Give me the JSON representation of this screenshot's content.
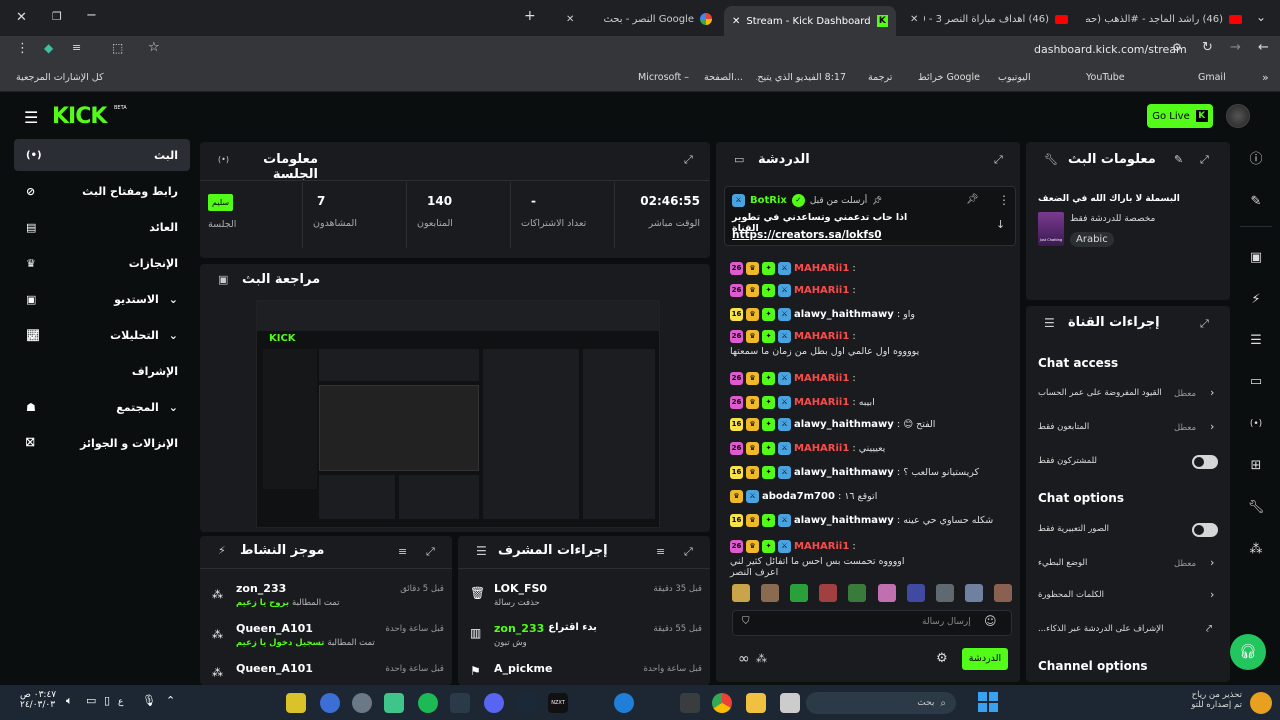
{
  "browser": {
    "tabs": [
      {
        "label": "(46) راشد الماجد - #الذهب (حصر"
      },
      {
        "label": "(46) أهداف مباراة النصر 3 - 0 الـ"
      },
      {
        "label": "Stream - Kick Dashboard"
      },
      {
        "label": "النصر - بحث Google"
      }
    ],
    "url": "dashboard.kick.com/stream",
    "bookmarks": [
      "Gmail",
      "YouTube",
      "اليوتيوب",
      "خرائط Google",
      "ترجمة",
      "8:17 الفيديو الذي يتيح...",
      "الصفحة...",
      "Microsoft –"
    ],
    "all_bookmarks": "كل الإشارات المرجعية"
  },
  "header": {
    "logo": "KICK",
    "beta": "BETA",
    "go_live": "Go Live"
  },
  "sidebar": {
    "items": [
      {
        "label": "البث",
        "icon": "broadcast-icon"
      },
      {
        "label": "رابط ومفتاح البث",
        "icon": "link-icon"
      },
      {
        "label": "العائد",
        "icon": "revenue-icon"
      },
      {
        "label": "الإنجازات",
        "icon": "trophy-icon"
      },
      {
        "label": "الاستديو",
        "icon": "studio-icon"
      },
      {
        "label": "التحليلات",
        "icon": "analytics-icon"
      },
      {
        "label": "الإشراف",
        "icon": "moderation-icon"
      },
      {
        "label": "المجتمع",
        "icon": "community-icon"
      },
      {
        "label": "الإنزالات و الجوائز",
        "icon": "gift-icon"
      }
    ]
  },
  "session": {
    "title": "معلومات الجلسة",
    "stats": [
      {
        "value": "02:46:55",
        "label": "الوقت مباشر"
      },
      {
        "value": "-",
        "label": "تعداد الاشتراكات"
      },
      {
        "value": "140",
        "label": "المتابعون"
      },
      {
        "value": "7",
        "label": "المشاهدون"
      },
      {
        "value": "سليم",
        "label": "الجلسة"
      }
    ]
  },
  "preview": {
    "title": "مراجعة البث"
  },
  "activity": {
    "title": "موجز النشاط",
    "items": [
      {
        "user": "zon_233",
        "time": "قبل 5 دقائق",
        "text": "تمت المطالبة",
        "highlight": "بروح يا زعيم"
      },
      {
        "user": "Queen_A101",
        "time": "قبل ساعة واحدة",
        "text": "تمت المطالبة",
        "highlight": "تسجيل دخول يا زعيم"
      },
      {
        "user": "Queen_A101",
        "time": "قبل ساعة واحدة",
        "text": "",
        "highlight": ""
      }
    ]
  },
  "mod_actions": {
    "title": "إجراءات المشرف",
    "items": [
      {
        "user": "LOK_FS0",
        "time": "قبل 35 دقيقة",
        "text": "حذفت رسالة"
      },
      {
        "user": "zon_233",
        "prefix": "بدء اقتراع",
        "time": "قبل 55 دقيقة",
        "text": "وش تبون"
      },
      {
        "user": "A_pickme",
        "time": "قبل ساعة واحدة",
        "text": ""
      }
    ]
  },
  "chat": {
    "title": "الدردشة",
    "pinned": {
      "by": "أرسلت من قبل",
      "user": "BotRix",
      "text": "اذا حاب تدعمني وتساعدني في تطوير القناة",
      "link": "https://creators.sa/lokfs0"
    },
    "messages": [
      {
        "user": "MAHARii1",
        "text": "",
        "sub": "26",
        "color": "red"
      },
      {
        "user": "MAHARii1",
        "text": "",
        "sub": "26",
        "color": "red"
      },
      {
        "user": "alawy_haithmawy",
        "text": "واو",
        "sub": "16",
        "color": "white"
      },
      {
        "user": "MAHARii1",
        "text": "يووووه اول عالمي اول بطل من زمان ما سمعتها",
        "sub": "26",
        "color": "red"
      },
      {
        "user": "MAHARii1",
        "text": "",
        "sub": "26",
        "color": "red"
      },
      {
        "user": "MAHARii1",
        "text": "ابيبه",
        "sub": "26",
        "color": "red"
      },
      {
        "user": "alawy_haithmawy",
        "text": "الفتح 😊",
        "sub": "16",
        "color": "white"
      },
      {
        "user": "MAHARii1",
        "text": "يعيييني",
        "sub": "26",
        "color": "red"
      },
      {
        "user": "alawy_haithmawy",
        "text": "كريستيانو سالعب ؟",
        "sub": "16",
        "color": "white"
      },
      {
        "user": "aboda7m700",
        "text": "اتوقع ١٦",
        "sub": "",
        "color": "white"
      },
      {
        "user": "alawy_haithmawy",
        "text": "شكله حساوي حي عينه",
        "sub": "16",
        "color": "white"
      },
      {
        "user": "MAHARii1",
        "text": "اووووه تحمست بس احس ما اتفائل كثير لني اعرف النصر",
        "sub": "26",
        "color": "red"
      }
    ],
    "input_placeholder": "إرسال رسالة",
    "send_label": "الدردشة"
  },
  "stream_info": {
    "title": "معلومات البث",
    "stream_title": "البسملة لا باراك الله في الضعف",
    "subtitle": "مخصصة للدردشة فقط",
    "category": "Just Chatting",
    "language": "Arabic"
  },
  "channel_actions": {
    "title": "إجراءات القناة",
    "chat_access": "Chat access",
    "rows_access": [
      {
        "label": "القيود المفروضة على عمر الحساب",
        "state": "معطل"
      },
      {
        "label": "المتابعون فقط",
        "state": "معطل"
      },
      {
        "label": "للمشتركون فقط",
        "state": ""
      }
    ],
    "chat_options": "Chat options",
    "rows_options": [
      {
        "label": "الصور التعبيرية فقط",
        "state": ""
      },
      {
        "label": "الوضع البطيء",
        "state": "معطل"
      },
      {
        "label": "الكلمات المحظورة",
        "state": ""
      },
      {
        "label": "الإشراف على الدردشة عبر الذكاء...",
        "state": ""
      }
    ],
    "channel_options": "Channel options"
  },
  "taskbar": {
    "search": "بحث",
    "time": "٠٣:٤٧ ص",
    "date": "٢٤/٠٣/٠٣",
    "lang": "ع",
    "update_line1": "تحذير من رياح",
    "update_line2": "تم إصداره للتو"
  }
}
